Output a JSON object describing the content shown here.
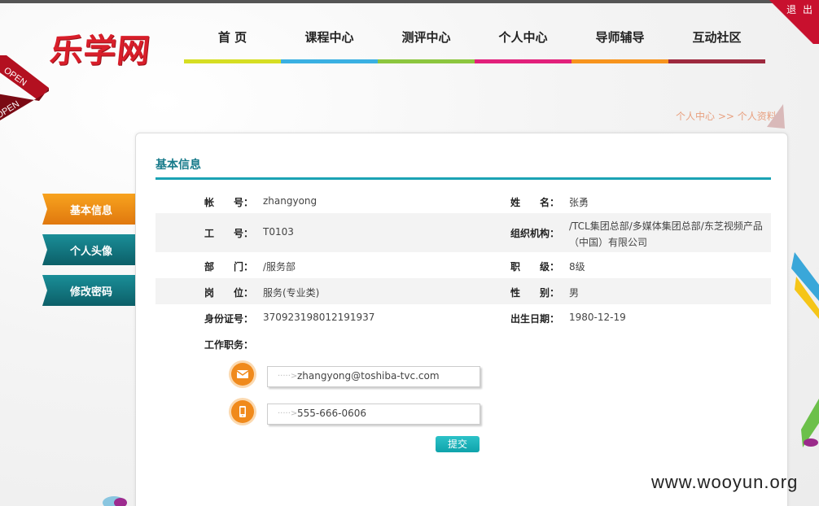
{
  "header": {
    "logo": "乐学网",
    "logout": "退 出",
    "nav": [
      {
        "label": "首 页",
        "color": "#d6de23"
      },
      {
        "label": "课程中心",
        "color": "#3ab0e2"
      },
      {
        "label": "测评中心",
        "color": "#8cc63f"
      },
      {
        "label": "个人中心",
        "color": "#e2207b"
      },
      {
        "label": "导师辅导",
        "color": "#f7941d"
      },
      {
        "label": "互动社区",
        "color": "#9e2a3f"
      }
    ],
    "ribbon_text": [
      "OPEN",
      "OPEN"
    ]
  },
  "breadcrumb": "个人中心 >> 个人资料",
  "sidebar": {
    "tabs": [
      {
        "label": "基本信息",
        "active": true
      },
      {
        "label": "个人头像",
        "active": false
      },
      {
        "label": "修改密码",
        "active": false
      }
    ]
  },
  "panel": {
    "title": "基本信息",
    "fields": {
      "account_label": "帐　　号：",
      "account": "zhangyong",
      "name_label": "姓　　名：",
      "name": "张勇",
      "employee_no_label": "工　　号：",
      "employee_no": "T0103",
      "org_label": "组织机构：",
      "org": "/TCL集团总部/多媒体集团总部/东芝视频产品（中国）有限公司",
      "dept_label": "部　　门：",
      "dept": "/服务部",
      "level_label": "职　　级：",
      "level": "8级",
      "post_label": "岗　　位：",
      "post": "服务(专业类)",
      "gender_label": "性　　别：",
      "gender": "男",
      "id_label": "身份证号：",
      "id_number": "370923198012191937",
      "birth_label": "出生日期：",
      "birth": "1980-12-19",
      "duty_label": "工作职务："
    },
    "contacts": {
      "email": "zhangyong@toshiba-tvc.com",
      "email_icon": "mail-icon",
      "phone": "555-666-0606",
      "phone_icon": "phone-icon",
      "arrow": "·····>"
    },
    "submit": "提交"
  },
  "watermark": "www.wooyun.org"
}
